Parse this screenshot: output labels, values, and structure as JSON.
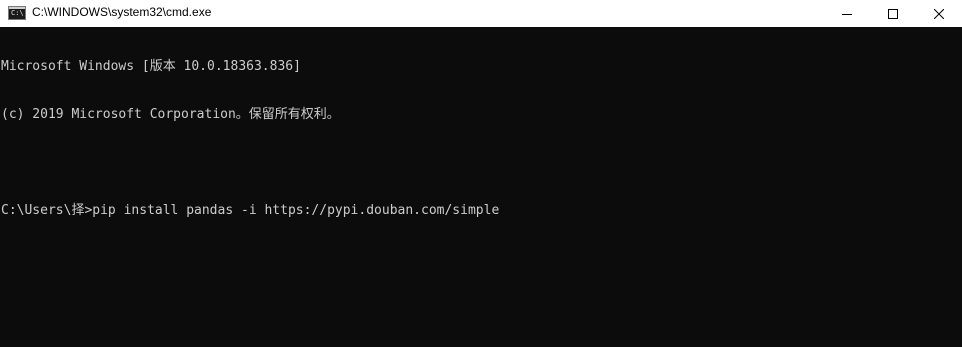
{
  "window": {
    "title": "C:\\WINDOWS\\system32\\cmd.exe",
    "icon": "cmd-console-icon",
    "icon_label": "C:\\"
  },
  "caption_buttons": {
    "minimize_icon": "minimize-icon",
    "maximize_icon": "maximize-icon",
    "close_icon": "close-icon"
  },
  "console": {
    "lines": [
      "Microsoft Windows [版本 10.0.18363.836]",
      "(c) 2019 Microsoft Corporation。保留所有权利。",
      ""
    ],
    "prompt": "C:\\Users\\择>",
    "command": "pip install pandas -i https://pypi.douban.com/simple"
  },
  "colors": {
    "console_background": "#0c0c0c",
    "console_text": "#cccccc",
    "titlebar_background": "#ffffff"
  }
}
